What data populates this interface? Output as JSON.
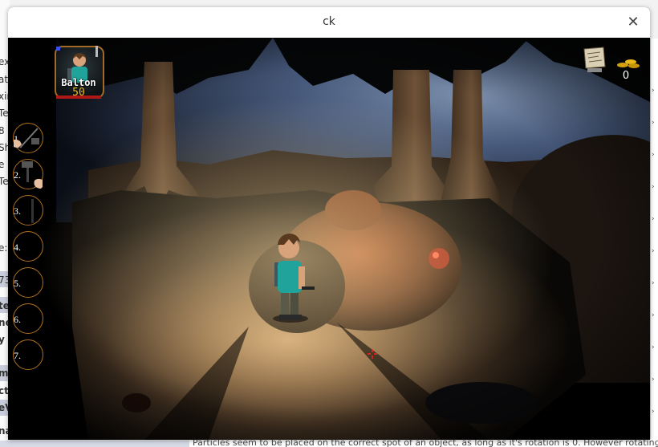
{
  "window": {
    "title": "ck"
  },
  "hud": {
    "character": {
      "name": "Balton",
      "value": "50"
    },
    "slots": [
      {
        "label": "1.",
        "item": "pickaxe"
      },
      {
        "label": "2.",
        "item": "torch-hand"
      },
      {
        "label": "3.",
        "item": "staff"
      },
      {
        "label": "4.",
        "item": ""
      },
      {
        "label": "5.",
        "item": ""
      },
      {
        "label": "6.",
        "item": ""
      },
      {
        "label": "7.",
        "item": ""
      }
    ],
    "gold": "0"
  },
  "background_text": {
    "left_column": [
      "ex",
      "ati",
      "xin",
      "Te",
      "8",
      "Sh",
      "e",
      "Te",
      "e:",
      "73",
      "te",
      "ne",
      "y",
      "m",
      "ct",
      "eV",
      "na"
    ],
    "bottom_line": "Particles seem to be placed on the correct spot of an object, as long as it's rotation is 0. However rotating it with"
  },
  "colors": {
    "ring": "#b0701e",
    "health": "#b01818",
    "value_text": "#f0c020",
    "player_shirt": "#1fa39a"
  }
}
